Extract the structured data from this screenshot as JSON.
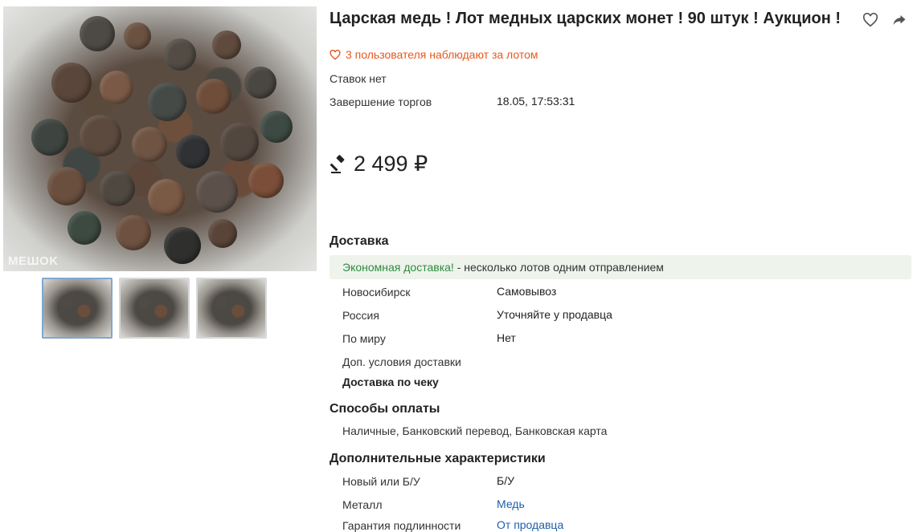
{
  "lot": {
    "title": "Царская медь ! Лот медных царских монет ! 90 штук ! Аукцион !",
    "watchers": "3 пользователя наблюдают за лотом",
    "bids": "Ставок нет",
    "end_label": "Завершение торгов",
    "end_value": "18.05, 17:53:31",
    "price": "2 499 ₽"
  },
  "gallery": {
    "watermark": "MEШOK",
    "thumbnail_count": 3
  },
  "delivery": {
    "heading": "Доставка",
    "promo_highlight": "Экономная доставка!",
    "promo_text": " - несколько лотов одним отправлением",
    "rows": [
      {
        "label": "Новосибирск",
        "value": "Самовывоз"
      },
      {
        "label": "Россия",
        "value": "Уточняйте у продавца"
      },
      {
        "label": "По миру",
        "value": "Нет"
      },
      {
        "label": "Доп. условия доставки",
        "value": ""
      }
    ],
    "extra": "Доставка по чеку"
  },
  "payment": {
    "heading": "Способы оплаты",
    "methods": "Наличные, Банковский перевод, Банковская карта"
  },
  "specs": {
    "heading": "Дополнительные характеристики",
    "rows": [
      {
        "label": "Новый или Б/У",
        "value": "Б/У"
      },
      {
        "label": "Металл",
        "value": "Медь"
      },
      {
        "label": "Гарантия подлинности",
        "value": "От продавца"
      }
    ]
  },
  "colors": {
    "accent_orange": "#e8571e",
    "promo_green": "#2e8b3d",
    "link_blue": "#1f5ea8"
  },
  "icons": [
    "heart-icon",
    "share-icon",
    "auction-hammer-icon"
  ]
}
